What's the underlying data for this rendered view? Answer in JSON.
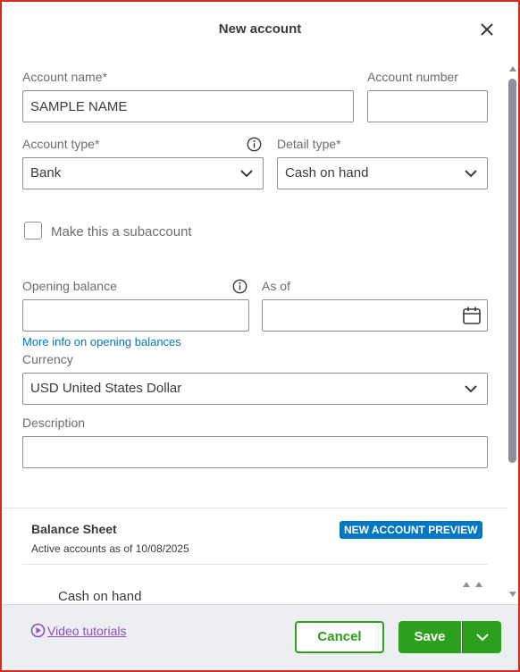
{
  "dialog": {
    "title": "New account",
    "close_icon": "close-icon"
  },
  "form": {
    "account_name": {
      "label": "Account name*",
      "value": "SAMPLE NAME"
    },
    "account_number": {
      "label": "Account number",
      "value": ""
    },
    "account_type": {
      "label": "Account type*",
      "value": "Bank",
      "info_icon": "info-icon"
    },
    "detail_type": {
      "label": "Detail type*",
      "value": "Cash on hand"
    },
    "subaccount": {
      "label": "Make this a subaccount",
      "checked": false
    },
    "opening_balance": {
      "label": "Opening balance",
      "value": "",
      "info_icon": "info-icon"
    },
    "as_of": {
      "label": "As of",
      "value": "",
      "icon": "calendar-icon"
    },
    "more_info_link": "More info on opening balances",
    "currency": {
      "label": "Currency",
      "value": "USD United States Dollar"
    },
    "description": {
      "label": "Description",
      "value": ""
    }
  },
  "preview": {
    "title": "Balance Sheet",
    "subtitle": "Active accounts as of 10/08/2025",
    "badge": "NEW ACCOUNT PREVIEW",
    "row_label": "Cash on hand"
  },
  "footer": {
    "video_tutorials": "Video tutorials",
    "cancel_label": "Cancel",
    "save_label": "Save"
  },
  "colors": {
    "primary_green": "#2ca01c",
    "link_blue": "#0077c5",
    "badge_blue": "#0077c5",
    "video_link_purple": "#8d4ec0",
    "frame_red": "#d52b1e"
  }
}
